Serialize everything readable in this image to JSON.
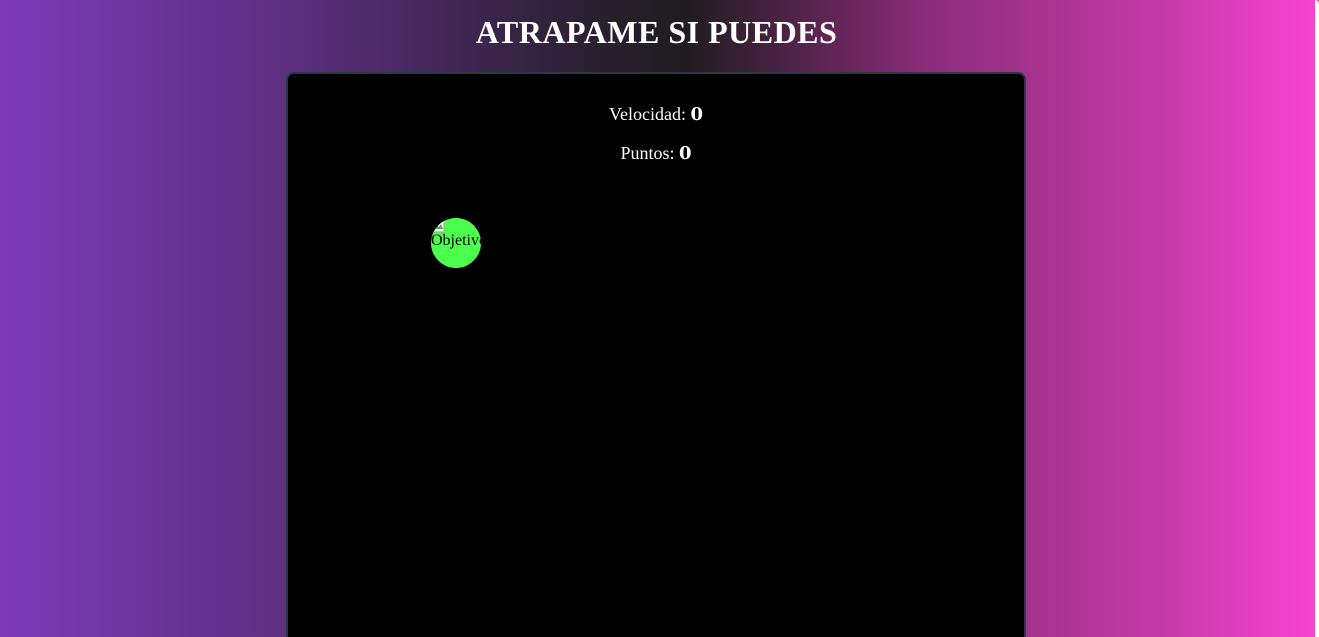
{
  "game": {
    "title": "ATRAPAME SI PUEDES",
    "speed_label": "Velocidad: ",
    "speed_value": "0",
    "points_label": "Puntos: ",
    "points_value": "0",
    "target_alt": "Objetivo"
  },
  "colors": {
    "board_bg": "#000000",
    "target": "#4dff4d",
    "text": "#ffffff"
  },
  "icons": {
    "target_image": "broken-image-icon"
  }
}
